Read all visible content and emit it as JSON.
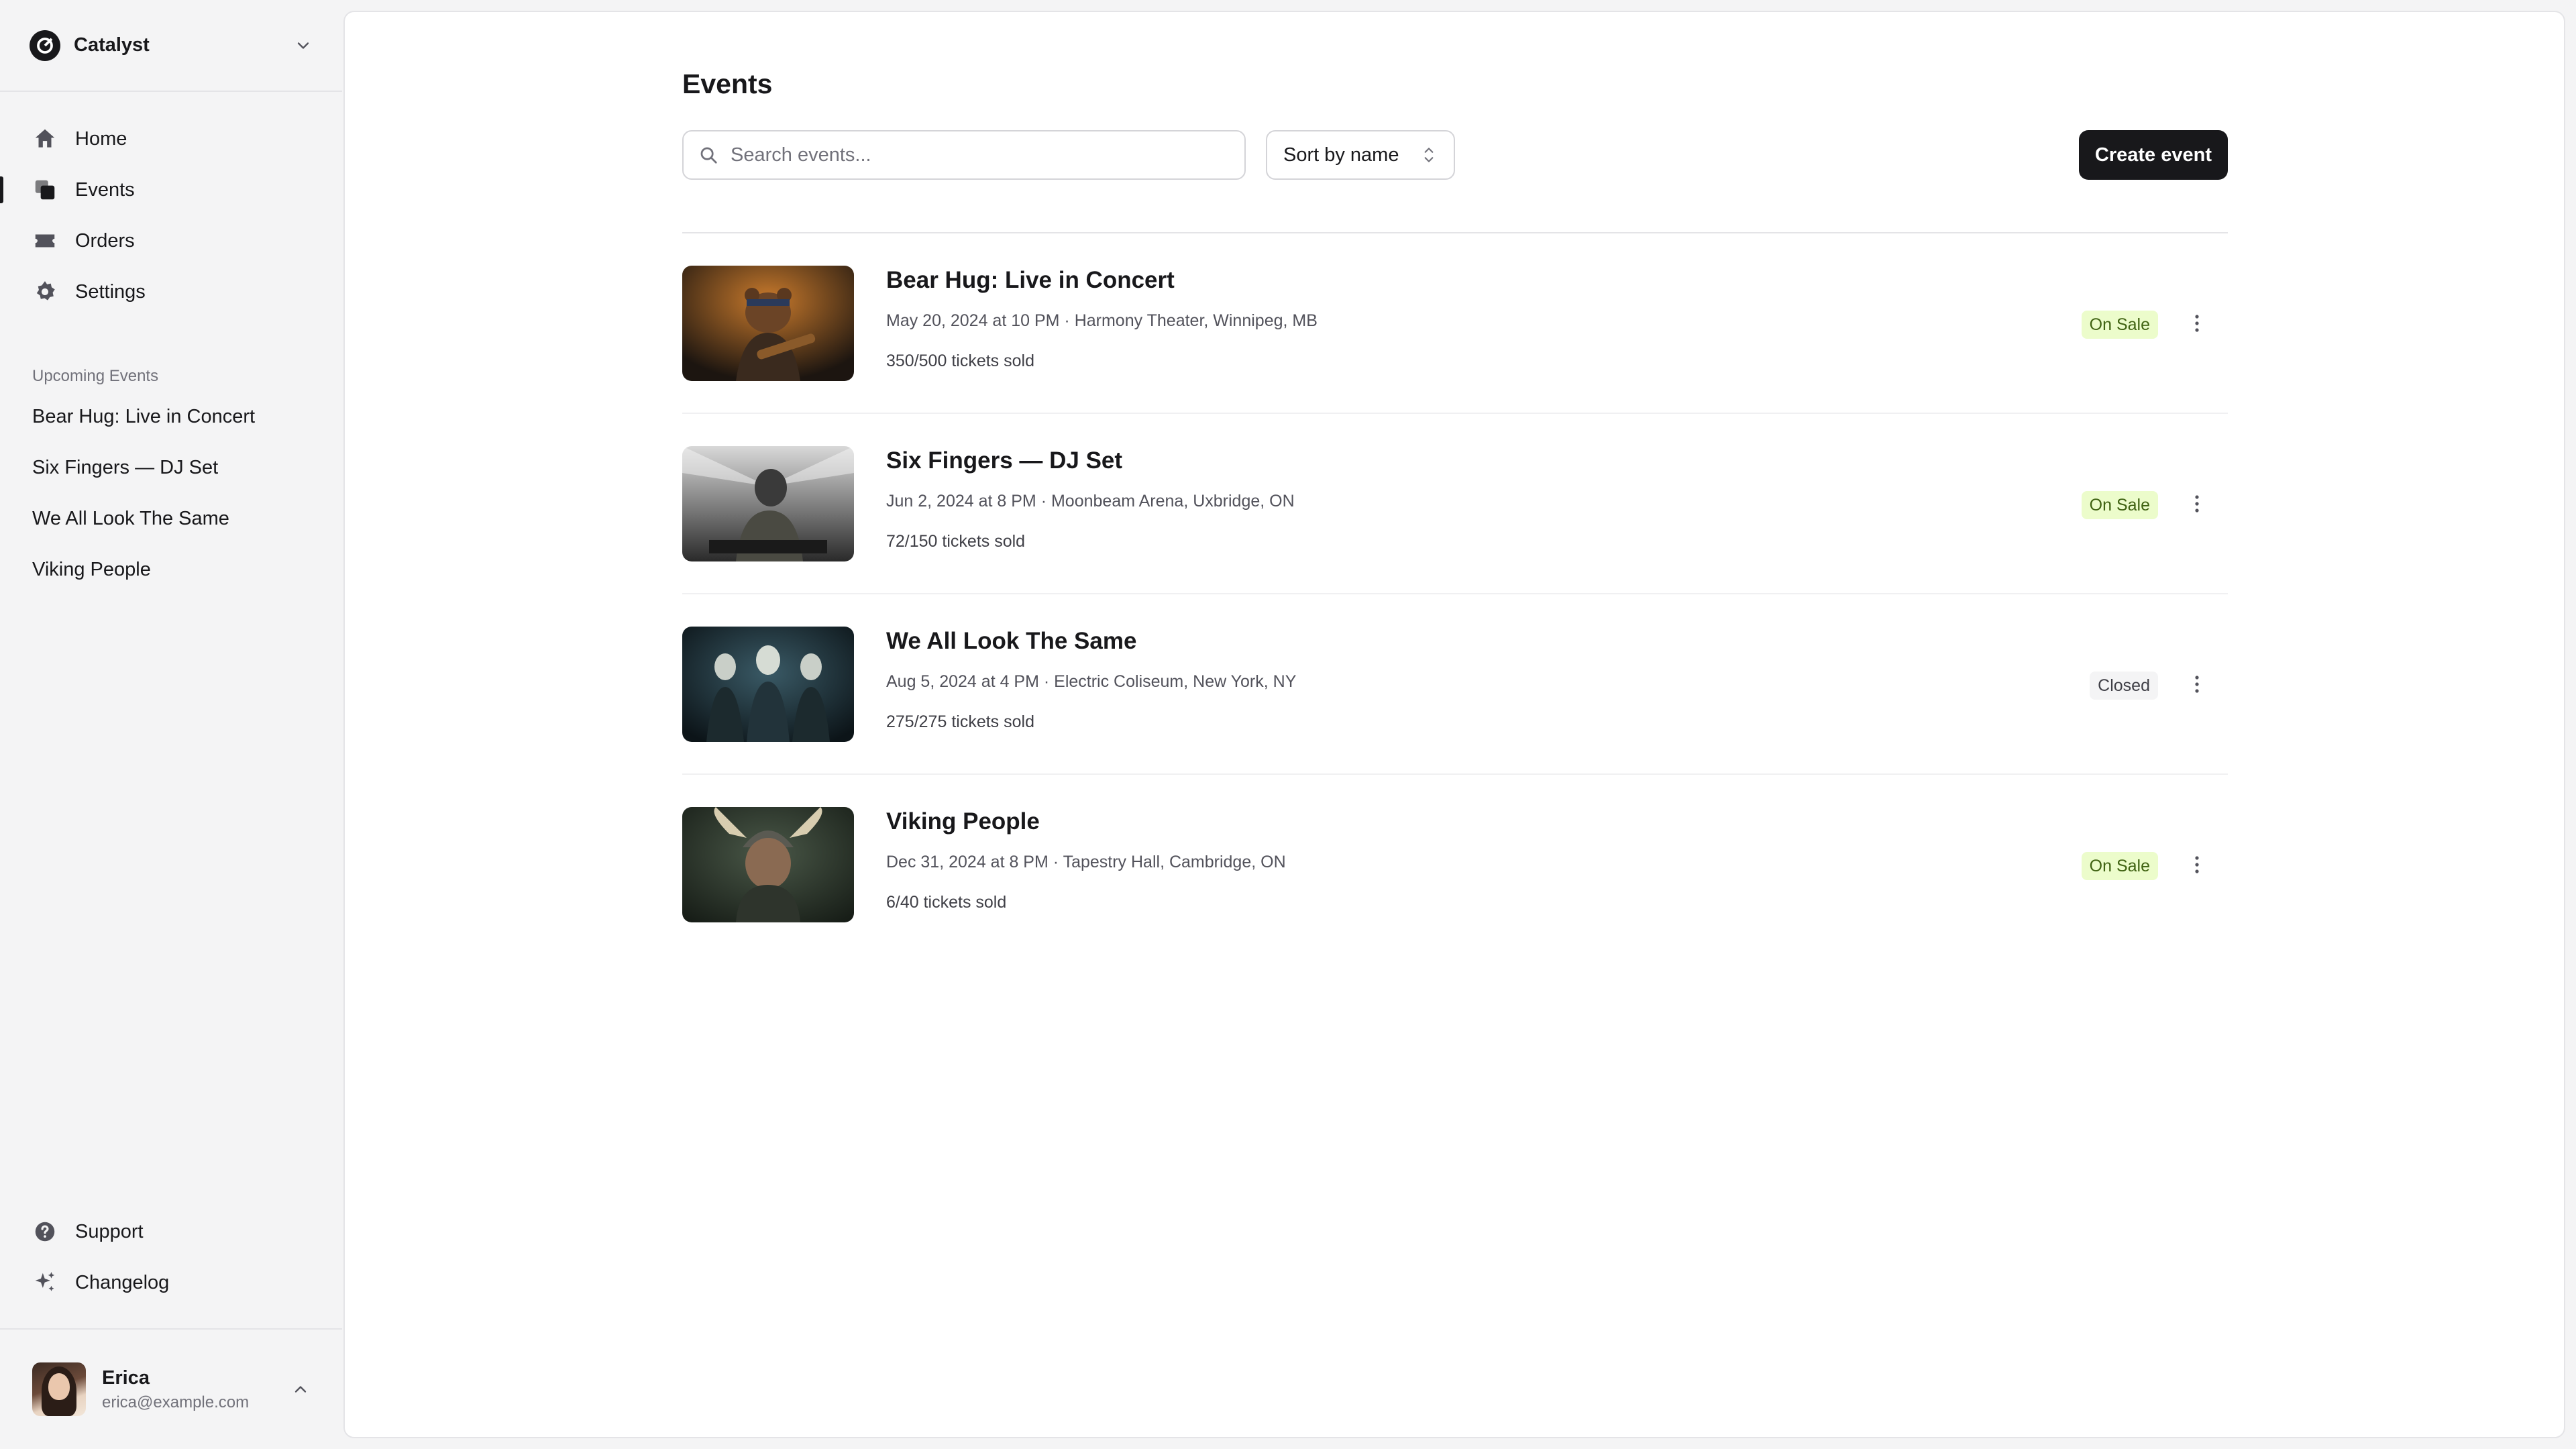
{
  "team": {
    "name": "Catalyst"
  },
  "nav": {
    "items": [
      {
        "label": "Home"
      },
      {
        "label": "Events"
      },
      {
        "label": "Orders"
      },
      {
        "label": "Settings"
      }
    ]
  },
  "upcoming": {
    "heading": "Upcoming Events",
    "items": [
      {
        "label": "Bear Hug: Live in Concert"
      },
      {
        "label": "Six Fingers — DJ Set"
      },
      {
        "label": "We All Look The Same"
      },
      {
        "label": "Viking People"
      }
    ]
  },
  "bottom_nav": {
    "items": [
      {
        "label": "Support"
      },
      {
        "label": "Changelog"
      }
    ]
  },
  "user": {
    "name": "Erica",
    "email": "erica@example.com"
  },
  "main": {
    "title": "Events",
    "search_placeholder": "Search events...",
    "sort_label": "Sort by name",
    "create_label": "Create event"
  },
  "events": [
    {
      "title": "Bear Hug: Live in Concert",
      "meta": "May 20, 2024 at 10 PM · Harmony Theater, Winnipeg, MB",
      "sold": "350/500 tickets sold",
      "status": "On Sale"
    },
    {
      "title": "Six Fingers — DJ Set",
      "meta": "Jun 2, 2024 at 8 PM · Moonbeam Arena, Uxbridge, ON",
      "sold": "72/150 tickets sold",
      "status": "On Sale"
    },
    {
      "title": "We All Look The Same",
      "meta": "Aug 5, 2024 at 4 PM · Electric Coliseum, New York, NY",
      "sold": "275/275 tickets sold",
      "status": "Closed"
    },
    {
      "title": "Viking People",
      "meta": "Dec 31, 2024 at 8 PM · Tapestry Hall, Cambridge, ON",
      "sold": "6/40 tickets sold",
      "status": "On Sale"
    }
  ],
  "colors": {
    "on_sale_bg": "#ecfccb",
    "on_sale_text": "#3f6212",
    "closed_bg": "#f4f4f5",
    "primary": "#18181b"
  },
  "icons": {
    "team": "catalyst-logo-icon",
    "home": "home-icon",
    "events": "events-icon",
    "orders": "ticket-icon",
    "settings": "gear-icon",
    "support": "question-circle-icon",
    "changelog": "sparkles-icon",
    "search": "search-icon",
    "sort": "chevron-up-down-icon",
    "more": "ellipsis-vertical-icon"
  }
}
